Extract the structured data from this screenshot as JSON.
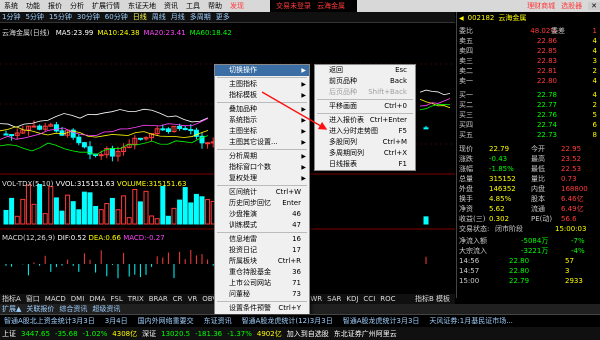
{
  "menubar": {
    "items": [
      "系统",
      "功能",
      "报价",
      "分析",
      "扩展行情",
      "东证天地",
      "资讯",
      "工具",
      "帮助",
      "发现"
    ],
    "center": [
      "交易未登录",
      "云海金属"
    ],
    "right": [
      "理财商城",
      "选股器"
    ]
  },
  "toolbar": {
    "items": [
      "1分钟",
      "5分钟",
      "15分钟",
      "30分钟",
      "60分钟",
      "日线",
      "周线",
      "月线",
      "多周期",
      "更多"
    ],
    "active": "日线"
  },
  "chart": {
    "title": "云海金属(日线)",
    "ma": [
      {
        "label": "MA5:",
        "value": "23.99",
        "color": "#ffffff"
      },
      {
        "label": "MA10:",
        "value": "24.38",
        "color": "#ffff00"
      },
      {
        "label": "MA20:",
        "value": "23.41",
        "color": "#ff44ff"
      },
      {
        "label": "MA60:",
        "value": "18.42",
        "color": "#00ff00"
      }
    ],
    "vol": {
      "label": "VOL-TDX(5,10)",
      "vvol_label": "VVOL:",
      "vvol": "315151.63",
      "volume_label": "VOLUME:",
      "volume": "315151.63"
    },
    "macd": {
      "label": "MACD(12,26,9)",
      "dif_label": "DIF:",
      "dif": "0.52",
      "dea_label": "DEA:",
      "dea": "0.66",
      "macd_label": "MACD:",
      "macd": "-0.27"
    },
    "bottom_tabs": [
      "指标A",
      "窗口",
      "MACD",
      "DMI",
      "DMA",
      "FSL",
      "TRIX",
      "BRAR",
      "CR",
      "VR",
      "OBV",
      "ASI",
      "EMV",
      "VOL-TDX",
      "RSI",
      "WR",
      "SAR",
      "KDJ",
      "CCI",
      "ROC"
    ],
    "bottom_tabs2": [
      "扩展▲",
      "关联报价",
      "综合资讯",
      "超级资讯"
    ],
    "right_label": "指标B 模板"
  },
  "context_menu": {
    "items": [
      {
        "label": "切换操作",
        "arrow": "▶",
        "selected": true
      },
      {
        "sep": true
      },
      {
        "label": "主图指标",
        "arrow": "▶"
      },
      {
        "label": "指标模板",
        "arrow": "▶"
      },
      {
        "sep": true
      },
      {
        "label": "叠加品种",
        "arrow": "▶"
      },
      {
        "label": "系统指示",
        "arrow": "▶"
      },
      {
        "label": "主图坐标",
        "arrow": "▶"
      },
      {
        "label": "主图其它设置...",
        "arrow": "▶"
      },
      {
        "sep": true
      },
      {
        "label": "分析周期",
        "arrow": "▶"
      },
      {
        "label": "指标窗口个数",
        "arrow": "▶"
      },
      {
        "label": "复权处理",
        "arrow": "▶"
      },
      {
        "sep": true
      },
      {
        "label": "区间统计",
        "shortcut": "Ctrl+W"
      },
      {
        "label": "历史同步回忆",
        "shortcut": "Enter"
      },
      {
        "label": "沙盘推演",
        "shortcut": "46"
      },
      {
        "label": "训练模式",
        "shortcut": "47"
      },
      {
        "sep": true
      },
      {
        "label": "信息地雷",
        "shortcut": "16"
      },
      {
        "label": "投资日记",
        "shortcut": "17"
      },
      {
        "label": "所属板块",
        "shortcut": "Ctrl+R"
      },
      {
        "label": "重仓持股基金",
        "shortcut": "36"
      },
      {
        "label": "上市公司网站",
        "shortcut": "71"
      },
      {
        "label": "问董秘",
        "shortcut": "73"
      },
      {
        "sep": true
      },
      {
        "label": "设置条件预警",
        "shortcut": "Ctrl+Y"
      },
      {
        "label": "标记当前品种",
        "arrow": "▶"
      },
      {
        "label": "加入到自选股",
        "shortcut": "Alt+Z"
      }
    ]
  },
  "submenu": {
    "items": [
      {
        "label": "返回",
        "shortcut": "Esc"
      },
      {
        "label": "前页品种",
        "shortcut": "Back"
      },
      {
        "label": "后页品种",
        "shortcut": "Shift+Back",
        "disabled": true
      },
      {
        "sep": true
      },
      {
        "label": "平移画面",
        "shortcut": "Ctrl+0"
      },
      {
        "sep": true
      },
      {
        "label": "进入报价表",
        "shortcut": "Ctrl+Enter"
      },
      {
        "label": "进入分时走势图",
        "shortcut": "F5"
      },
      {
        "label": "多股同列",
        "shortcut": "Ctrl+M"
      },
      {
        "label": "多周期同列",
        "shortcut": "Ctrl+X"
      },
      {
        "label": "日线报表",
        "shortcut": "F1"
      }
    ]
  },
  "quote": {
    "code": "002182",
    "name": "云海金属",
    "weibi_label": "委比",
    "weibi": "48.02%",
    "weicha_label": "委差",
    "weicha": "1",
    "sell": [
      {
        "label": "卖五",
        "price": "22.86",
        "vol": "4"
      },
      {
        "label": "卖四",
        "price": "22.85",
        "vol": "4"
      },
      {
        "label": "卖三",
        "price": "22.83",
        "vol": "3"
      },
      {
        "label": "卖二",
        "price": "22.81",
        "vol": "2"
      },
      {
        "label": "卖一",
        "price": "22.80",
        "vol": "4"
      }
    ],
    "buy": [
      {
        "label": "买一",
        "price": "22.78",
        "vol": "4"
      },
      {
        "label": "买二",
        "price": "22.77",
        "vol": "2"
      },
      {
        "label": "买三",
        "price": "22.76",
        "vol": "5"
      },
      {
        "label": "买四",
        "price": "22.74",
        "vol": "6"
      },
      {
        "label": "买五",
        "price": "22.73",
        "vol": "8"
      }
    ],
    "stats": [
      {
        "l": "现价",
        "v": "22.79",
        "l2": "今开",
        "v2": "22.95"
      },
      {
        "l": "涨跌",
        "v": "-0.43",
        "l2": "最高",
        "v2": "23.52"
      },
      {
        "l": "涨幅",
        "v": "-1.85%",
        "l2": "最低",
        "v2": "22.53"
      },
      {
        "l": "总量",
        "v": "315152",
        "l2": "量比",
        "v2": "0.73"
      },
      {
        "l": "外盘",
        "v": "146352",
        "l2": "内盘",
        "v2": "168800"
      },
      {
        "l": "换手",
        "v": "4.85%",
        "l2": "股本",
        "v2": "6.46亿"
      },
      {
        "l": "净资",
        "v": "5.62",
        "l2": "流通",
        "v2": "6.49亿"
      },
      {
        "l": "收益(三)",
        "v": "0.302",
        "l2": "PE(动)",
        "v2": "56.6"
      }
    ],
    "status_label": "交易状态:",
    "status": "闭市阶段",
    "time": "15:00:03",
    "flow": [
      {
        "l": "净流入额",
        "v": "-5084万",
        "p": "-7%"
      },
      {
        "l": "大宗流入",
        "v": "-3221万",
        "p": "-4%"
      }
    ],
    "ticks": [
      {
        "t": "14:56",
        "p": "22.80",
        "v": "57"
      },
      {
        "t": "14:57",
        "p": "22.80",
        "v": "3"
      },
      {
        "t": "15:00",
        "p": "22.79",
        "v": "2933"
      }
    ]
  },
  "ticker": {
    "items": [
      "智通A股北上资金统计3月3日",
      "3月4日",
      "国内外网络重要交",
      "东证资讯",
      "智通A股龙虎统计(12)3月3日",
      "智通A股龙虎统计3月3日",
      "天风证券:1月基民证市场..."
    ]
  },
  "statusbar": {
    "items": [
      {
        "t": "上证",
        "c": "#ffffff"
      },
      {
        "t": "3447.65",
        "c": "#00ff00"
      },
      {
        "t": "-35.68",
        "c": "#00ff00"
      },
      {
        "t": "-1.02%",
        "c": "#00ff00"
      },
      {
        "t": "4308亿",
        "c": "#ffff00"
      },
      {
        "t": "深证",
        "c": "#ffffff"
      },
      {
        "t": "13020.5",
        "c": "#00ff00"
      },
      {
        "t": "-181.36",
        "c": "#00ff00"
      },
      {
        "t": "-1.37%",
        "c": "#00ff00"
      },
      {
        "t": "4902亿",
        "c": "#ffff00"
      },
      {
        "t": "加入到自选股",
        "c": "#ffffff"
      },
      {
        "t": "东北证券广州阿里云",
        "c": "#ffffff"
      }
    ]
  },
  "colors": {
    "up": "#ff3b3b",
    "down": "#00ffff",
    "green": "#00ff00",
    "yellow": "#ffff00",
    "highlight": "#3a6ea5"
  }
}
